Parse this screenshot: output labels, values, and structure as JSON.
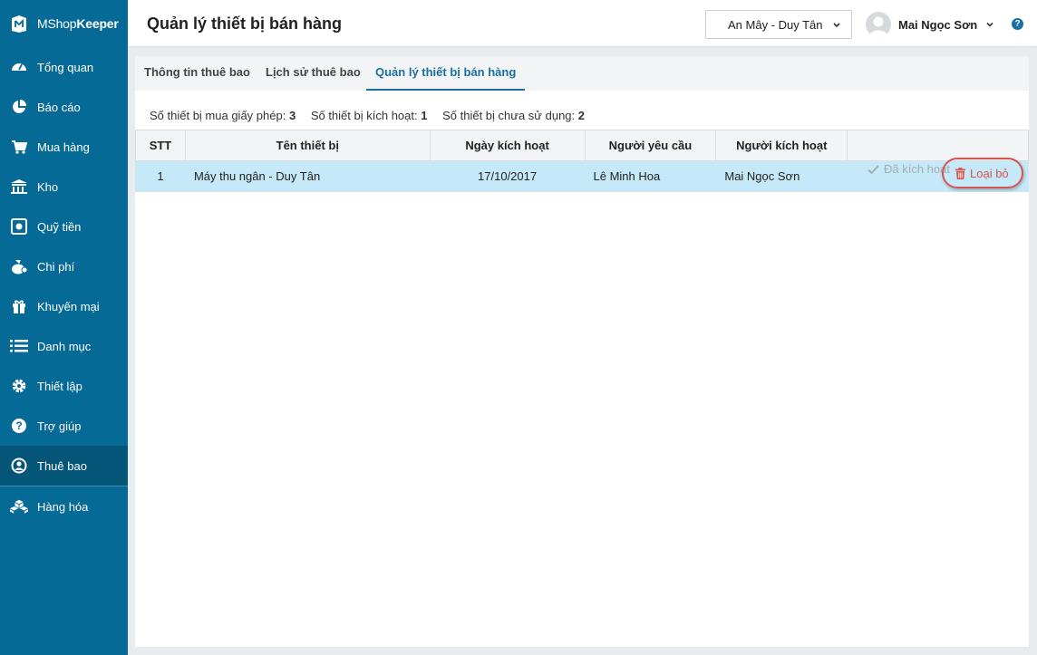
{
  "app": {
    "brand_prefix": "MShop",
    "brand_suffix": "Keeper"
  },
  "sidebar": {
    "items": [
      {
        "label": "Tổng quan",
        "icon": "dashboard-icon"
      },
      {
        "label": "Báo cáo",
        "icon": "pie-chart-icon"
      },
      {
        "label": "Mua hàng",
        "icon": "cart-icon"
      },
      {
        "label": "Kho",
        "icon": "warehouse-icon"
      },
      {
        "label": "Quỹ tiền",
        "icon": "safe-icon"
      },
      {
        "label": "Chi phí",
        "icon": "money-bag-icon"
      },
      {
        "label": "Khuyến mại",
        "icon": "gift-icon"
      },
      {
        "label": "Danh mục",
        "icon": "list-icon"
      },
      {
        "label": "Thiết lập",
        "icon": "gear-icon"
      },
      {
        "label": "Trợ giúp",
        "icon": "help-icon"
      },
      {
        "label": "Thuê bao",
        "icon": "user-icon"
      },
      {
        "label": "Hàng hóa",
        "icon": "boxes-icon"
      }
    ]
  },
  "header": {
    "title": "Quản lý thiết bị bán hàng",
    "store_selected": "An Mây - Duy Tân",
    "user_name": "Mai Ngọc Sơn",
    "help_glyph": "?"
  },
  "tabs": [
    {
      "label": "Thông tin thuê bao"
    },
    {
      "label": "Lịch sử thuê bao"
    },
    {
      "label": "Quản lý thiết bị bán hàng"
    }
  ],
  "stats": {
    "licensed_label": "Số thiết bị mua giấy phép:",
    "licensed_value": "3",
    "activated_label": "Số thiết bị kích hoạt:",
    "activated_value": "1",
    "unused_label": "Số thiết bị chưa sử dụng:",
    "unused_value": "2"
  },
  "table": {
    "headers": [
      "STT",
      "Tên thiết bị",
      "Ngày kích hoạt",
      "Người yêu cầu",
      "Người kích hoạt",
      ""
    ],
    "rows": [
      {
        "stt": "1",
        "name": "Máy thu ngân - Duy Tân",
        "date": "17/10/2017",
        "requester": "Lê Minh Hoa",
        "activator": "Mai Ngọc Sơn",
        "status": "Đã kích hoạt",
        "action": "Loại bỏ"
      }
    ]
  },
  "colors": {
    "sidebar": "#066a96",
    "sidebar_active": "#055578",
    "accent": "#1a6ea3",
    "row_selected": "#c5e9f8",
    "danger": "#d9534f"
  }
}
